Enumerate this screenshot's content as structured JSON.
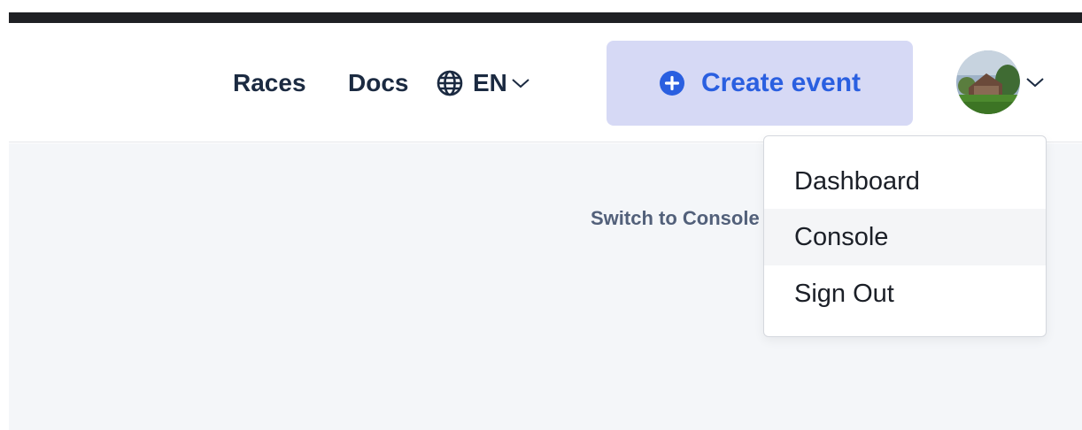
{
  "nav": {
    "races_label": "Races",
    "docs_label": "Docs",
    "language_label": "EN"
  },
  "create_event": {
    "label": "Create event",
    "icon": "plus-circle-icon",
    "background": "#d6d9f5",
    "color": "#2a5fe0"
  },
  "user_menu": {
    "avatar_icon": "avatar",
    "items": [
      {
        "label": "Dashboard"
      },
      {
        "label": "Console",
        "hovered": true
      },
      {
        "label": "Sign Out"
      }
    ]
  },
  "main": {
    "switch_text": "Switch to Console"
  },
  "colors": {
    "nav_text": "#1b2a41",
    "content_bg": "#f4f6f9",
    "top_bar": "#1f2024"
  }
}
